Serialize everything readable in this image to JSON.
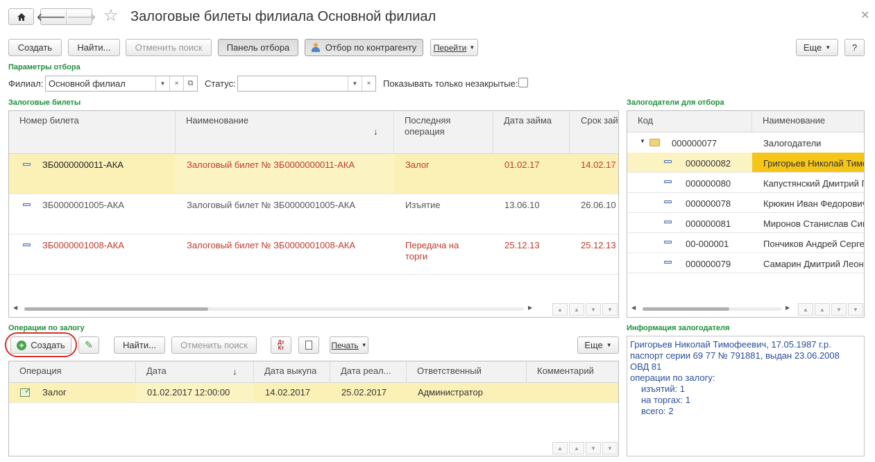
{
  "window": {
    "title": "Залоговые билеты филиала Основной филиал"
  },
  "toolbar": {
    "create": "Создать",
    "find": "Найти...",
    "cancel_search": "Отменить поиск",
    "filter_panel": "Панель отбора",
    "by_counterparty": "Отбор по контрагенту",
    "goto": "Перейти",
    "more": "Еще",
    "help": "?"
  },
  "filter": {
    "section": "Параметры отбора",
    "branch_label": "Филиал:",
    "branch_value": "Основной филиал",
    "status_label": "Статус:",
    "status_value": "",
    "only_open_label": "Показывать только незакрытые:"
  },
  "tickets": {
    "section": "Залоговые билеты",
    "headers": [
      "Номер билета",
      "Наименование",
      "Последняя операция",
      "Дата займа",
      "Срок зай"
    ],
    "rows": [
      {
        "number": "ЗБ0000000011-АКА",
        "name": "Залоговый билет № ЗБ0000000011-АКА",
        "operation": "Залог",
        "op2": "",
        "date": "01.02.17",
        "term": "14.02.17"
      },
      {
        "number": "ЗБ0000001005-АКА",
        "name": "Залоговый билет № ЗБ0000001005-АКА",
        "operation": "Изъятие",
        "op2": "",
        "date": "13.06.10",
        "term": "26.06.10"
      },
      {
        "number": "ЗБ0000001008-АКА",
        "name": "Залоговый билет № ЗБ0000001008-АКА",
        "operation": "Передача на",
        "op2": "торги",
        "date": "25.12.13",
        "term": "25.12.13"
      }
    ]
  },
  "pledgers": {
    "section": "Залогодатели для отбора",
    "headers": [
      "Код",
      "Наименование"
    ],
    "group": {
      "code": "000000077",
      "name": "Залогодатели"
    },
    "rows": [
      {
        "code": "000000082",
        "name": "Григорьев Николай Тимо"
      },
      {
        "code": "000000080",
        "name": "Капустянский Дмитрий Г"
      },
      {
        "code": "000000078",
        "name": "Крюкин Иван Федорович"
      },
      {
        "code": "000000081",
        "name": "Миронов Станислав Сим"
      },
      {
        "code": "00-000001",
        "name": "Пончиков Андрей Серге"
      },
      {
        "code": "000000079",
        "name": "Самарин Дмитрий Леони"
      }
    ]
  },
  "operations": {
    "section": "Операции по залогу",
    "create": "Создать",
    "find": "Найти...",
    "cancel_search": "Отменить поиск",
    "print": "Печать",
    "more": "Еще",
    "headers": [
      "Операция",
      "Дата",
      "Дата выкупа",
      "Дата реал...",
      "Ответственный",
      "Комментарий"
    ],
    "rows": [
      {
        "operation": "Залог",
        "date": "01.02.2017 12:00:00",
        "redeem": "14.02.2017",
        "sale": "25.02.2017",
        "responsible": "Администратор",
        "comment": ""
      }
    ]
  },
  "info": {
    "section": "Информация залогодателя",
    "lines": [
      "Григорьев Николай Тимофеевич, 17.05.1987 г.р.",
      "паспорт серии 69 77 № 791881, выдан 23.06.2008",
      "ОВД 81",
      "операции по залогу:",
      "изъятий: 1",
      "на торгах: 1",
      "всего: 2"
    ]
  }
}
